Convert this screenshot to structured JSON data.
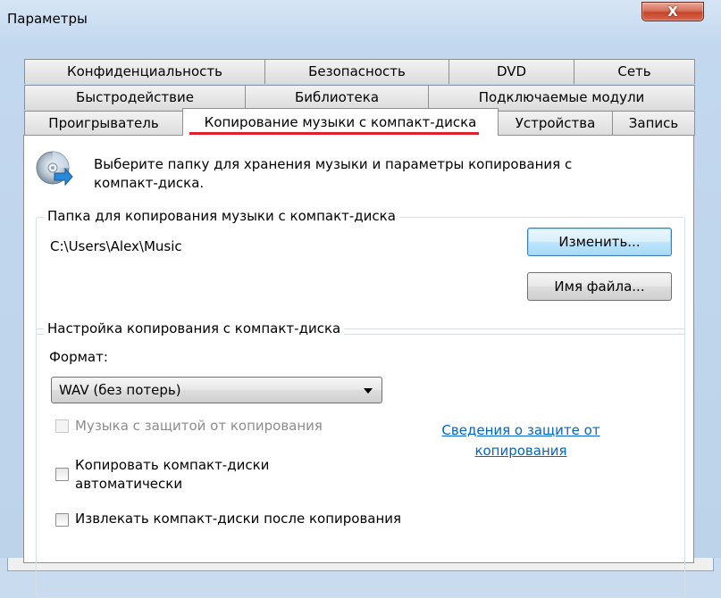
{
  "window": {
    "title": "Параметры",
    "close_glyph": "X"
  },
  "tabs": {
    "row1": [
      "Конфиденциальность",
      "Безопасность",
      "DVD",
      "Сеть"
    ],
    "row2": [
      "Быстродействие",
      "Библиотека",
      "Подключаемые модули"
    ],
    "row3": [
      "Проигрыватель",
      "Копирование музыки с компакт-диска",
      "Устройства",
      "Запись"
    ],
    "active": "Копирование музыки с компакт-диска"
  },
  "header": {
    "icon": "cd-rip-icon",
    "text_line1": "Выберите папку для хранения музыки и параметры копирования с",
    "text_line2": "компакт-диска."
  },
  "folder_group": {
    "legend": "Папка для копирования музыки с компакт-диска",
    "path": "C:\\Users\\Alex\\Music",
    "change_button": "Изменить...",
    "filename_button": "Имя файла..."
  },
  "rip_group": {
    "legend": "Настройка копирования с компакт-диска",
    "format_label": "Формат:",
    "format_value": "WAV (без потерь)",
    "copy_protect_label": "Музыка с защитой от копирования",
    "copy_protect_link_line1": "Сведения о защите от",
    "copy_protect_link_line2": "копирования",
    "auto_rip_line1": "Копировать компакт-диски",
    "auto_rip_line2": "автоматически",
    "eject_label": "Извлекать компакт-диски после копирования"
  },
  "colors": {
    "accent_underline": "#e0202a",
    "link": "#0066cc"
  }
}
